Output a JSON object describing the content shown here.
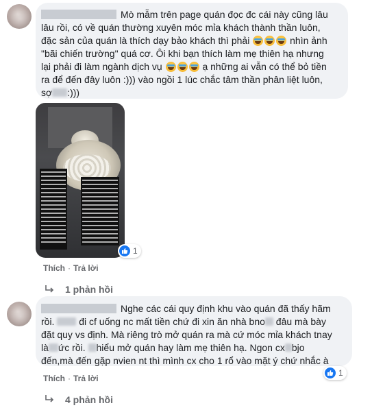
{
  "comments": [
    {
      "lines": [
        "Mò mẫm trên page quán đọc đc cái này cũng lâu",
        "lâu rồi, có về quán thường xuyên móc mỉa khách thành thần luôn,",
        "đặc sản của quán là thích dạy bảo khách thì phải",
        "nhìn ảnh",
        "\"bãi chiến trường\" quá cơ. Ôi khi bạn thích làm mẹ thiên hạ nhưng",
        "lại phải đi làm ngành dịch vụ",
        "ạ những ai vẫn có thể bỏ tiền",
        "ra để đến đây luôn :))) vào ngồi 1 lúc chắc tâm thần phân liệt luôn,",
        "sợ",
        ":)))"
      ],
      "reaction_count": "1",
      "actions": {
        "like": "Thích",
        "reply": "Trả lời",
        "separator": "·"
      },
      "replies_label": "1 phản hồi"
    },
    {
      "lines": [
        "Nghe các cái quy định khu vào quán đã thấy hãm",
        "rồi.",
        "đi cf uống nc mất tiền chứ đi xin ăn nhà bno",
        "đâu mà bày",
        "đặt quy vs định. Mà riêng trò mở quán ra mà cứ móc mỉa khách tnay",
        "là",
        "ức rồi.",
        "hiểu mở quán hay làm mẹ thiên hạ. Ngon cx",
        "bjo",
        "đến,mà đến gặp nvien nt thì mình cx cho 1 rổ vào mặt ý chứ nhắc à"
      ],
      "reaction_count": "1",
      "actions": {
        "like": "Thích",
        "reply": "Trả lời",
        "separator": "·"
      },
      "replies_label": "4 phản hồi"
    }
  ],
  "icons": [
    "avatar",
    "laughing-emoji",
    "like-icon",
    "reply-arrow-icon"
  ],
  "colors": {
    "bubble": "#f0f2f5",
    "text": "#1c1e21",
    "muted": "#65676b",
    "like_blue": "#1877f2"
  }
}
